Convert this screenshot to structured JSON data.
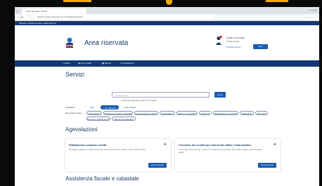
{
  "browser": {
    "tab_title": "Area riservata - Servizi",
    "url": "ivaservizi.agenziaentrate.gov.it/portale/web/guest",
    "nav_icons": "‹ › ⟳",
    "ext_icons": "☆ ⋯",
    "window_controls": "─ ☐ ✕"
  },
  "site": {
    "ministry_bar": "Ministero dell'Economia e delle Finanze",
    "title": "Area riservata",
    "user": {
      "name": "NOME COGNOME",
      "subtitle": "Codice fiscale",
      "switch_label": "Cambia utenza",
      "logout_label": "Esci"
    },
    "nav": [
      {
        "label": "Home"
      },
      {
        "label": "Il tuo profilo"
      },
      {
        "label": "Servizi"
      },
      {
        "label": "Assistenza"
      }
    ]
  },
  "services": {
    "title": "Servizi",
    "search_placeholder": "Cerca servizio",
    "search_button": "Cerca",
    "search_hint": "Ricerca avanzata o elenco completo",
    "filter_label_1": "Visualizza",
    "filter_label_2": "Per parole chiave",
    "view_chips": [
      {
        "label": "Tutti",
        "active": false
      },
      {
        "label": "I più utilizzati",
        "active": true
      },
      {
        "label": "I miei preferiti",
        "active": false
      }
    ],
    "keyword_chips": [
      {
        "label": "Agevolazioni"
      },
      {
        "label": "Assistenza fiscale e catastale"
      },
      {
        "label": "Comunicazioni e istanze"
      },
      {
        "label": "Dichiarazioni"
      },
      {
        "label": "Fatture e corrispettivi"
      },
      {
        "label": "Rimborsi"
      },
      {
        "label": "Registrazione e contratti"
      },
      {
        "label": "Pagamenti"
      },
      {
        "label": "Strumenti"
      },
      {
        "label": "Ricerca e verifica servizi"
      },
      {
        "label": "Altri servizi telematici"
      }
    ]
  },
  "agevolazioni": {
    "title": "Agevolazioni",
    "cards": [
      {
        "title": "Piattaforma cessione crediti",
        "text": "Consulta e gestisci i crediti d'imposta derivanti da bonus edilizi e altri crediti ceduti.",
        "button": "Vai al servizio"
      },
      {
        "title": "Cessione dei crediti per interventi edilizi e fotovoltaico",
        "text": "Comunica l'opzione per lo sconto in fattura o la cessione del credito relativo agli interventi edilizi.",
        "button": "Vai al servizio"
      }
    ]
  },
  "assistenza": {
    "title": "Assistenza fiscale e catastale"
  },
  "colors": {
    "navy": "#123a70",
    "primary_blue": "#1a5bb0",
    "accent": "#f2a900",
    "bezel": "#0a0a0a"
  }
}
